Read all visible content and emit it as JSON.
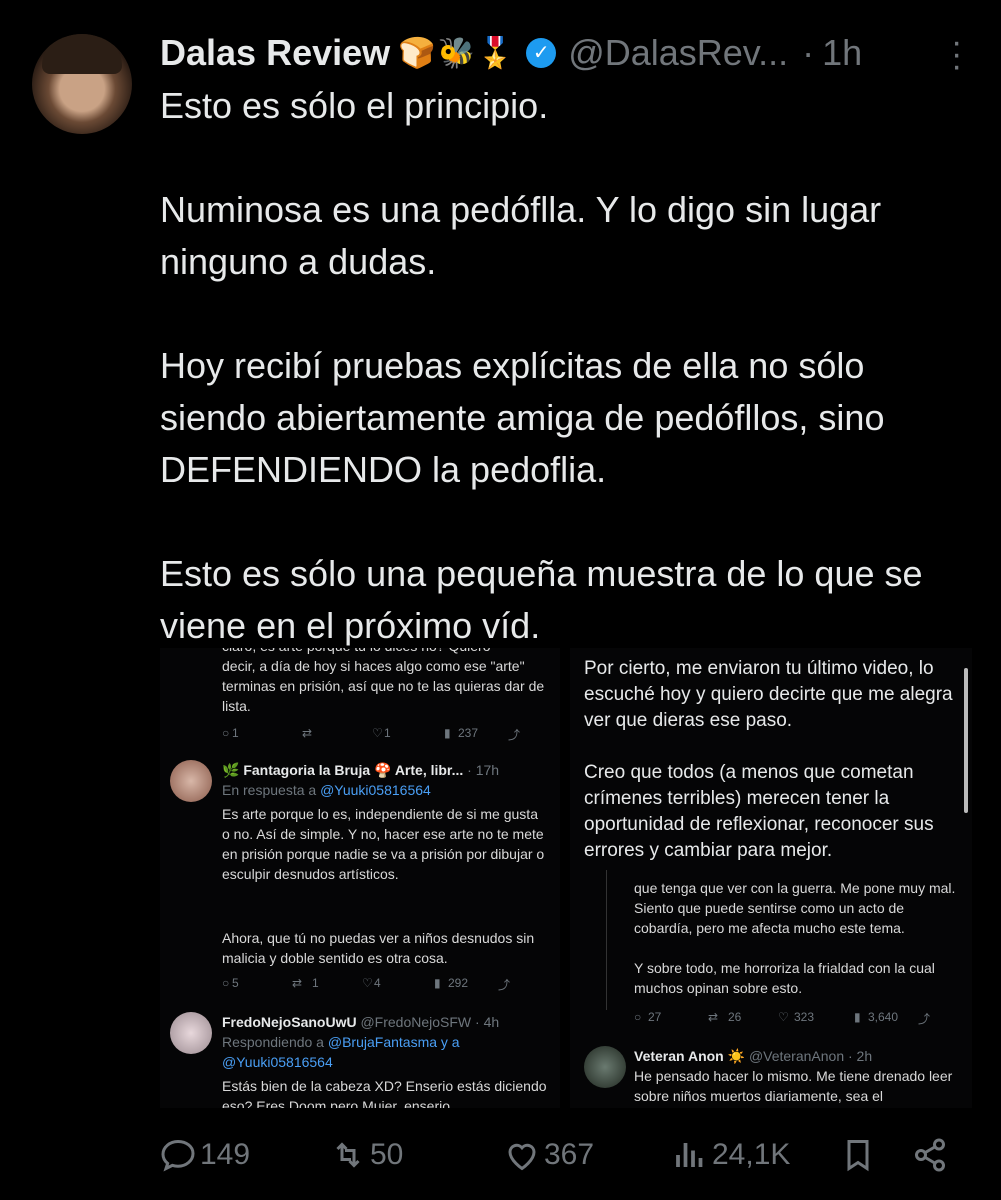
{
  "tweet": {
    "author_name": "Dalas Review",
    "author_emojis": "🍞🐝🎖️",
    "verified_icon": "verified-badge-icon",
    "handle": "@DalasRev...",
    "dot": "·",
    "time": "1h",
    "paragraphs": [
      "Esto es sólo el principio.",
      "Numinosa es una pedóflla. Y lo digo sin lugar ninguno a dudas.",
      "Hoy recibí pruebas explícitas de ella no sólo siendo abiertamente amiga de pedófllos, sino DEFENDIENDO la pedoflia.",
      "Esto es sólo una pequeña muestra de lo que se viene en el próximo víd."
    ]
  },
  "media_left": {
    "top_text_cut": "claro, es arte porque tu lo dices no? Quiero",
    "top_text": "decir, a día de hoy si haces algo como ese \"arte\" terminas en prisión, así que no te las quieras dar de lista.",
    "top_actions": {
      "replies": "1",
      "reposts": "",
      "likes": "1",
      "views": "237"
    },
    "reply1": {
      "name": "🌿 Fantagoria la Bruja 🍄 Arte, libr...",
      "time": "· 17h",
      "in_reply_prefix": "En respuesta a ",
      "in_reply_handle": "@Yuuki05816564",
      "text1": "Es arte porque lo es, independiente de si me gusta o no. Así de simple. Y no, hacer ese arte no te mete en prisión porque nadie se va a prisión por dibujar o esculpir desnudos artísticos.",
      "text2": "Ahora, que tú no puedas ver a niños desnudos sin malicia y doble sentido es otra cosa.",
      "actions": {
        "replies": "5",
        "reposts": "1",
        "likes": "4",
        "views": "292"
      }
    },
    "reply2": {
      "name": "FredoNejoSanoUwU",
      "handle": "@FredoNejoSFW · 4h",
      "in_reply_prefix": "Respondiendo a ",
      "in_reply_handle": "@BrujaFantasma y a @Yuuki05816564",
      "text": "Estás bien de la cabeza XD? Enserio estás diciendo eso? Eres Doom pero Mujer, enserio"
    }
  },
  "media_right": {
    "message1": "Por cierto, me enviaron tu último video, lo escuché hoy y quiero decirte que me alegra ver que dieras ese paso.",
    "message2": "Creo que todos (a menos que cometan crímenes terribles) merecen tener la oportunidad de reflexionar, reconocer sus errores y cambiar para mejor.",
    "cut_text": "que tenga que ver con la guerra. Me pone muy mal. Siento que puede sentirse como un acto de cobardía, pero me afecta mucho este tema.",
    "text2": "Y sobre todo, me horroriza la frialdad con la cual muchos opinan sobre esto.",
    "actions": {
      "replies": "27",
      "reposts": "26",
      "likes": "323",
      "views": "3,640"
    },
    "reply": {
      "name": "Veteran Anon ☀️",
      "handle": "@VeteranAnon · 2h",
      "text": "He pensado hacer lo mismo. Me tiene drenado leer sobre niños muertos diariamente, sea el"
    }
  },
  "footer": {
    "replies": "149",
    "reposts": "50",
    "likes": "367",
    "views": "24,1K"
  }
}
